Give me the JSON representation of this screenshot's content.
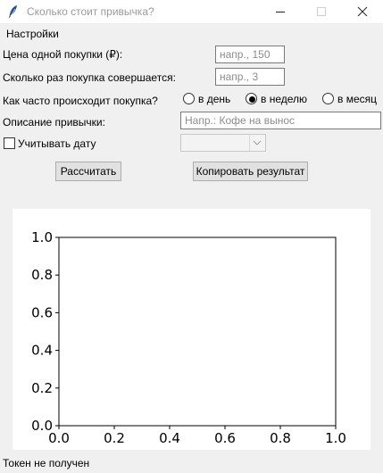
{
  "window": {
    "title": "Сколько стоит привычка?",
    "icon": "feather-icon",
    "controls": [
      "minimize-icon",
      "maximize-icon",
      "close-icon"
    ]
  },
  "menu": {
    "settings": "Настройки"
  },
  "form": {
    "price_label": "Цена одной покупки (₽):",
    "price_placeholder": "напр., 150",
    "count_label": "Сколько раз покупка совершается:",
    "count_placeholder": "напр., 3",
    "frequency_label": "Как часто происходит покупка?",
    "frequency_options": [
      {
        "label": "в день",
        "selected": false
      },
      {
        "label": "в неделю",
        "selected": true
      },
      {
        "label": "в месяц",
        "selected": false
      }
    ],
    "description_label": "Описание привычки:",
    "description_placeholder": "Напр.: Кофе на вынос",
    "date_checkbox_label": "Учитывать дату",
    "date_checkbox_checked": false,
    "date_select_value": ""
  },
  "buttons": {
    "calculate": "Рассчитать",
    "copy": "Копировать результат"
  },
  "chart_data": {
    "type": "line",
    "series": [],
    "xlim": [
      0.0,
      1.0
    ],
    "ylim": [
      0.0,
      1.0
    ],
    "x_ticks": [
      "0.0",
      "0.2",
      "0.4",
      "0.6",
      "0.8",
      "1.0"
    ],
    "y_ticks": [
      "0.0",
      "0.2",
      "0.4",
      "0.6",
      "0.8",
      "1.0"
    ],
    "title": "",
    "xlabel": "",
    "ylabel": "",
    "grid": false
  },
  "status": {
    "text": "Токен не получен"
  },
  "colors": {
    "window_bg": "#f0f0f0",
    "titlebar_bg": "#ffffff",
    "title_text": "#9a9a9a",
    "button_bg": "#e1e1e1",
    "plot_bg": "#ffffff"
  }
}
